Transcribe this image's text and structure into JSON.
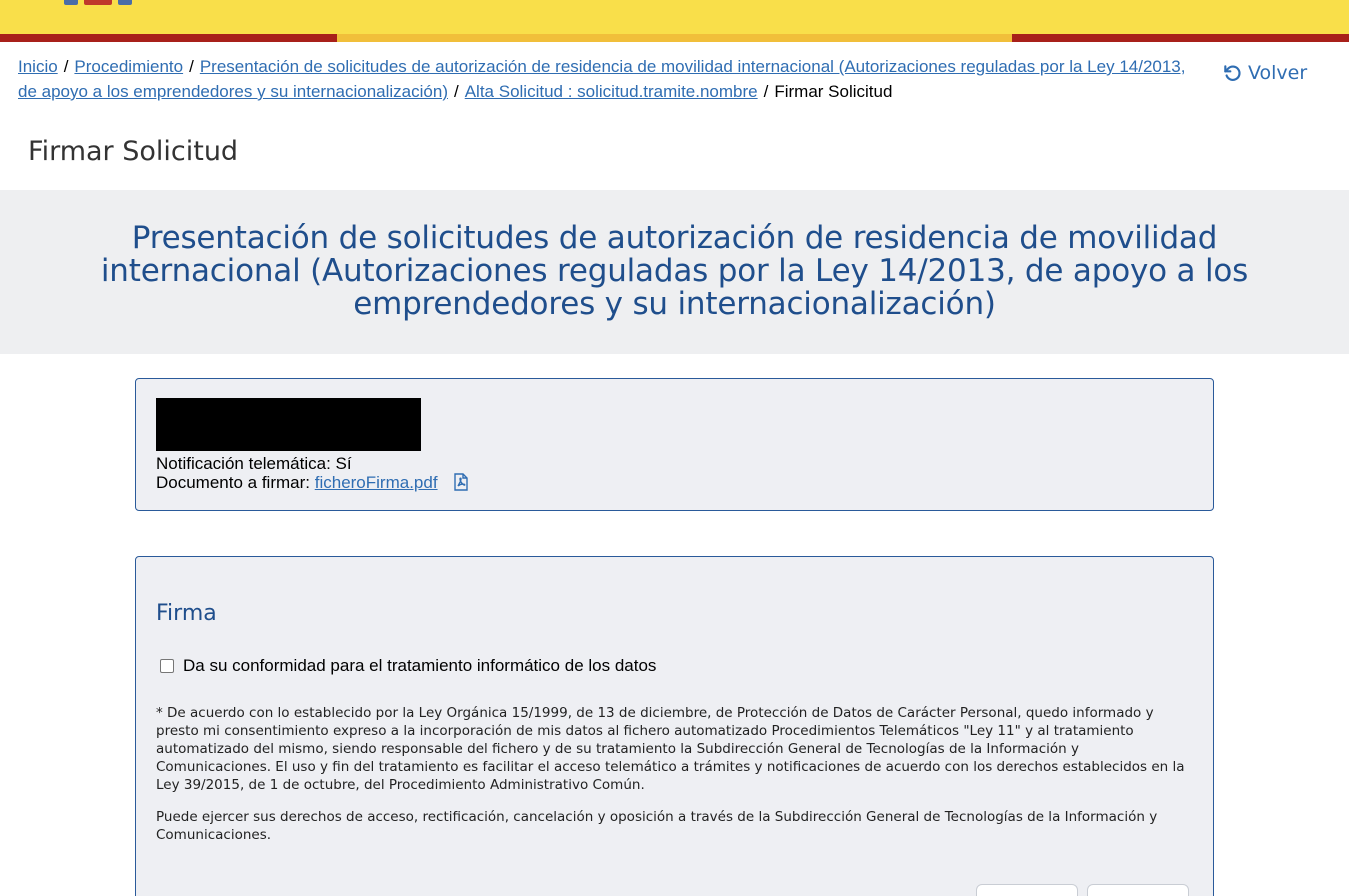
{
  "header": {
    "colors": {
      "yellow": "#f9df4a",
      "red": "#a8201a",
      "accent_yellow": "#f1bf3a"
    }
  },
  "breadcrumb": {
    "items": [
      {
        "label": "Inicio",
        "link": true
      },
      {
        "label": "Procedimiento",
        "link": true
      },
      {
        "label": "Presentación de solicitudes de autorización de residencia de movilidad internacional (Autorizaciones reguladas por la Ley 14/2013, de apoyo a los emprendedores y su internacionalización)",
        "link": true
      },
      {
        "label": "Alta Solicitud : solicitud.tramite.nombre",
        "link": true
      },
      {
        "label": "Firmar Solicitud",
        "link": false
      }
    ],
    "separator": "/"
  },
  "volver": {
    "label": "Volver",
    "icon": "undo-icon"
  },
  "page_title": "Firmar Solicitud",
  "banner": {
    "title": "Presentación de solicitudes de autorización de residencia de movilidad internacional (Autorizaciones reguladas por la Ley 14/2013, de apoyo a los emprendedores y su internacionalización)"
  },
  "info_card": {
    "notificacion_label": "Notificación telemática:",
    "notificacion_value": "Sí",
    "documento_label": "Documento a firmar:",
    "documento_file": "ficheroFirma.pdf",
    "documento_icon": "pdf-file-icon"
  },
  "firma": {
    "heading": "Firma",
    "consent_label": "Da su conformidad para el tratamiento informático de los datos",
    "consent_checked": false,
    "legal_p1": "* De acuerdo con lo establecido por la Ley Orgánica 15/1999, de 13 de diciembre, de Protección de Datos de Carácter Personal, quedo informado y presto mi consentimiento expreso a la incorporación de mis datos al fichero automatizado Procedimientos Telemáticos \"Ley 11\" y al tratamiento automatizado del mismo, siendo responsable del fichero y de su tratamiento la Subdirección General de Tecnologías de la Información y Comunicaciones. El uso y fin del tratamiento es facilitar el acceso telemático a trámites y notificaciones de acuerdo con los derechos establecidos en la Ley 39/2015, de 1 de octubre, del Procedimiento Administrativo Común.",
    "legal_p2": "Puede ejercer sus derechos de acceso, rectificación, cancelación y oposición a través de la Subdirección General de Tecnologías de la Información y Comunicaciones."
  }
}
